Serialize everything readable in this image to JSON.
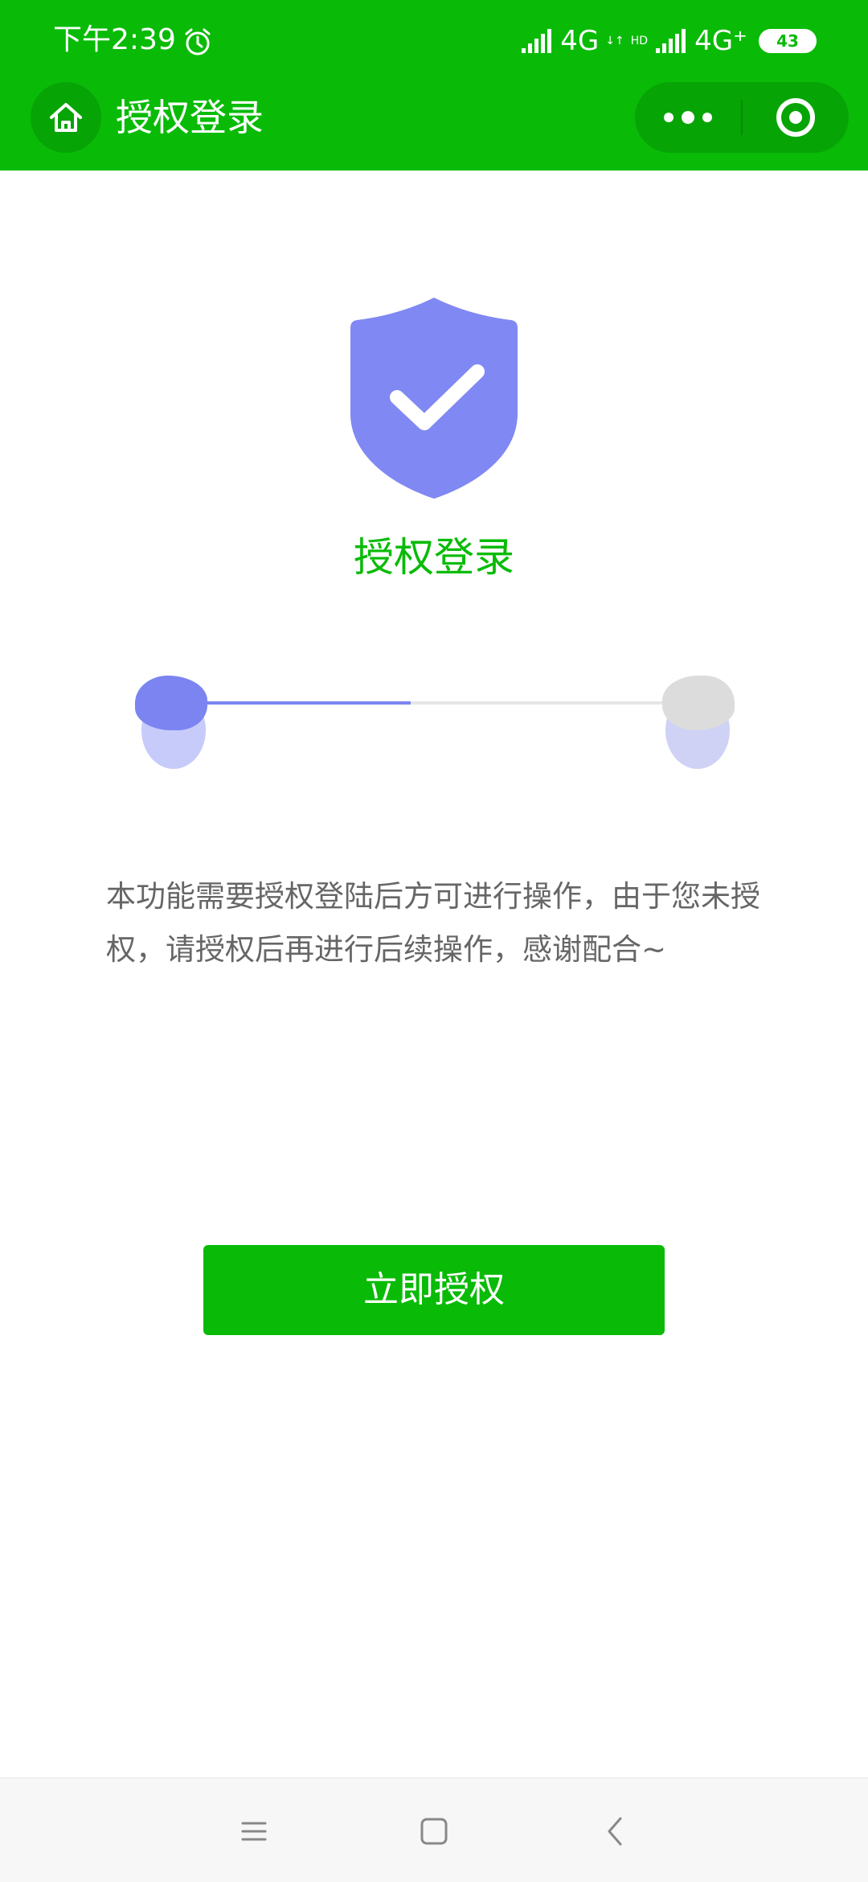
{
  "status_bar": {
    "time": "下午2:39",
    "network1": "4G",
    "network1_sup": "↓↑",
    "network2_prefix": "HD",
    "network2": "4G⁺",
    "battery": "43"
  },
  "nav": {
    "title": "授权登录",
    "home_icon": "home-icon",
    "more_icon": "more-dots-icon",
    "close_icon": "target-icon"
  },
  "main": {
    "title": "授权登录",
    "progress": 0.45,
    "description": "本功能需要授权登陆后方可进行操作，由于您未授权，请授权后再进行后续操作，感谢配合~",
    "button_label": "立即授权"
  },
  "colors": {
    "brand_green": "#09bb07",
    "accent_purple": "#7b84f0"
  }
}
